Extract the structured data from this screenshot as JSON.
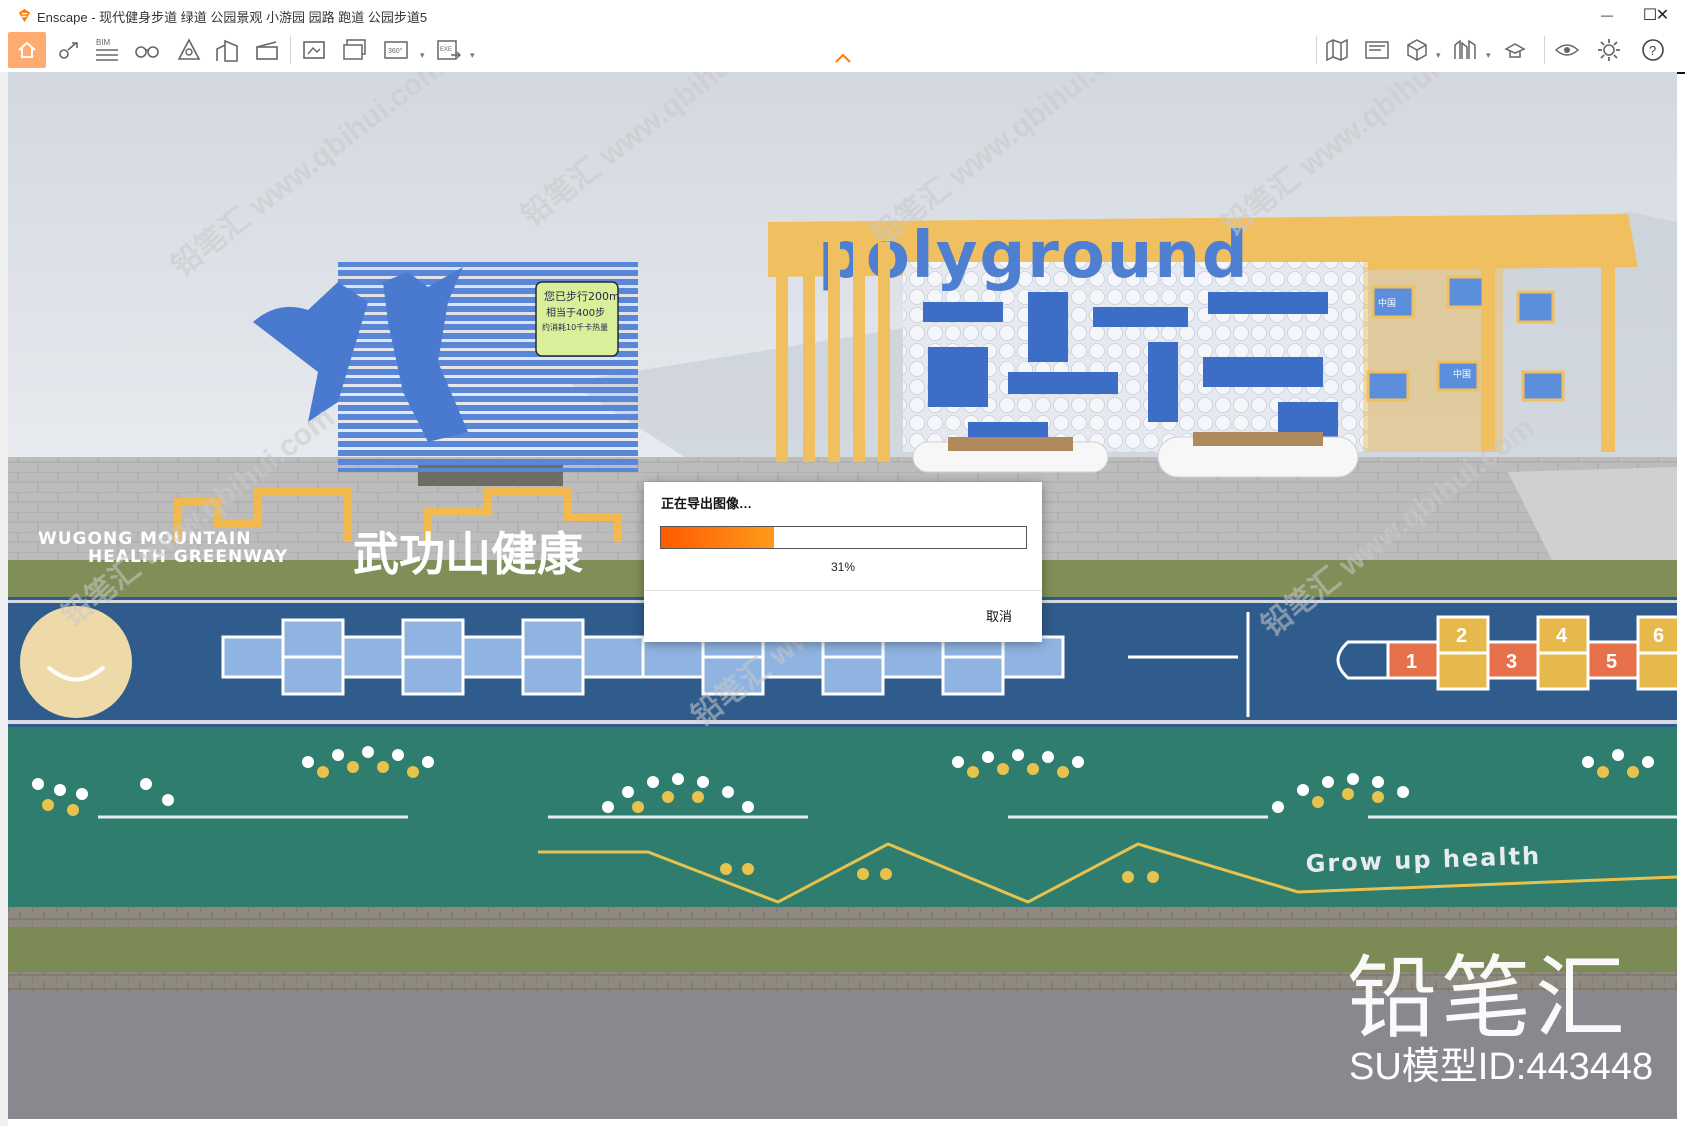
{
  "window": {
    "app_name": "Enscape",
    "title": "Enscape - 现代健身步道 绿道 公园景观 小游园 园路 跑道 公园步道5",
    "controls": {
      "minimize": "—",
      "maximize": "☐",
      "close": "✕"
    }
  },
  "toolbar": {
    "left_icons": [
      "home-icon",
      "location-pin-icon",
      "bim-icon",
      "binoculars-icon",
      "asset-library-icon",
      "buildings-icon",
      "clapper-icon",
      "screenshot-icon",
      "batch-render-icon",
      "panorama-360-icon",
      "exe-export-icon"
    ],
    "bim_label": "BIM",
    "pano_label": "360°",
    "exe_label": "EXE",
    "right_icons": [
      "map-icon",
      "views-icon",
      "cube-icon",
      "material-icon",
      "hat-icon",
      "eye-icon",
      "gear-icon",
      "help-icon"
    ],
    "help_label": "?"
  },
  "viewport": {
    "sign_lines": [
      "您已步行200m",
      "相当于400步",
      "约消耗10千卡热量"
    ],
    "polyground_text": "polyground",
    "wugong_en_line1": "WUGONG MOUNTAIN",
    "wugong_en_line2": "HEALTH GREENWAY",
    "wugong_cn": "武功山健康",
    "grow_text": "Grow up health",
    "hopscotch_numbers": [
      "1",
      "2",
      "3",
      "4",
      "5",
      "6"
    ],
    "flag_text": "中国"
  },
  "dialog": {
    "title": "正在导出图像…",
    "progress_percent": 31,
    "progress_label": "31%",
    "cancel_label": "取消"
  },
  "watermark": {
    "brand": "铅笔汇",
    "model_id": "SU模型ID:443448",
    "diagonal_text": "铅笔汇 www.qbihui.com"
  },
  "colors": {
    "accent": "#ff7a00",
    "track_blue": "#2f5c8c",
    "field_green": "#2f7d6e",
    "frame_orange": "#f0c060",
    "wall_blue": "#4f7fd0"
  }
}
